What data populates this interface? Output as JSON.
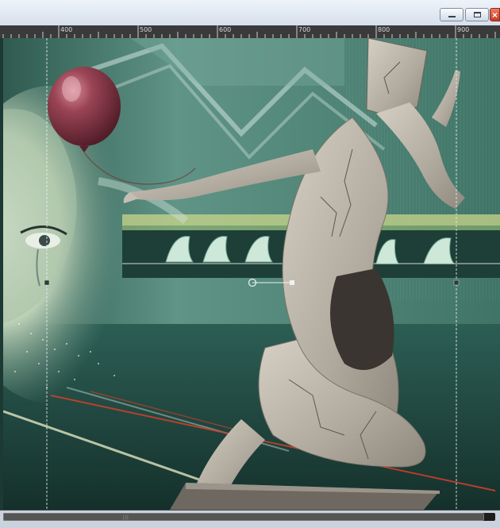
{
  "window": {
    "buttons": {
      "minimize": "minimize-icon",
      "maximize": "maximize-icon",
      "close": "close-icon"
    }
  },
  "ruler": {
    "labels": [
      "400",
      "500",
      "600",
      "700",
      "800",
      "900"
    ],
    "background": "#3a3a3a"
  },
  "canvas": {
    "subject": "artwork-layers",
    "colors": {
      "background": "#5e9183",
      "balloon": "#8b3447",
      "figure": "#b8b1a6",
      "accent_red": "#d2402a"
    }
  }
}
